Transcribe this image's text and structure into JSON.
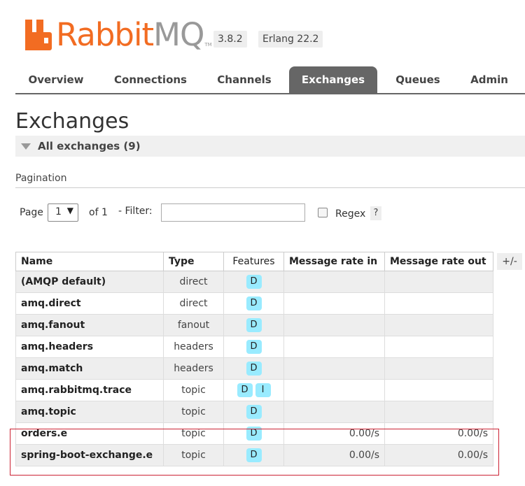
{
  "brand": {
    "logo_rabbit": "Rabbit",
    "logo_mq": "MQ",
    "logo_tm": "TM",
    "accent": "#f26c22"
  },
  "versions": {
    "rabbitmq": "3.8.2",
    "erlang": "Erlang 22.2"
  },
  "tabs": [
    {
      "label": "Overview",
      "active": false
    },
    {
      "label": "Connections",
      "active": false
    },
    {
      "label": "Channels",
      "active": false
    },
    {
      "label": "Exchanges",
      "active": true
    },
    {
      "label": "Queues",
      "active": false
    },
    {
      "label": "Admin",
      "active": false
    }
  ],
  "page": {
    "title": "Exchanges",
    "section_title": "All exchanges (9)"
  },
  "pagination": {
    "label": "Pagination",
    "page_label": "Page",
    "page_value": "1",
    "of_label": "of 1",
    "filter_label": "- Filter:",
    "filter_value": "",
    "regex_label": "Regex",
    "help_label": "?"
  },
  "table": {
    "columns": [
      "Name",
      "Type",
      "Features",
      "Message rate in",
      "Message rate out"
    ],
    "toggle_label": "+/-",
    "rows": [
      {
        "name": "(AMQP default)",
        "type": "direct",
        "features": [
          "D"
        ],
        "rate_in": "",
        "rate_out": ""
      },
      {
        "name": "amq.direct",
        "type": "direct",
        "features": [
          "D"
        ],
        "rate_in": "",
        "rate_out": ""
      },
      {
        "name": "amq.fanout",
        "type": "fanout",
        "features": [
          "D"
        ],
        "rate_in": "",
        "rate_out": ""
      },
      {
        "name": "amq.headers",
        "type": "headers",
        "features": [
          "D"
        ],
        "rate_in": "",
        "rate_out": ""
      },
      {
        "name": "amq.match",
        "type": "headers",
        "features": [
          "D"
        ],
        "rate_in": "",
        "rate_out": ""
      },
      {
        "name": "amq.rabbitmq.trace",
        "type": "topic",
        "features": [
          "D",
          "I"
        ],
        "rate_in": "",
        "rate_out": ""
      },
      {
        "name": "amq.topic",
        "type": "topic",
        "features": [
          "D"
        ],
        "rate_in": "",
        "rate_out": ""
      },
      {
        "name": "orders.e",
        "type": "topic",
        "features": [
          "D"
        ],
        "rate_in": "0.00/s",
        "rate_out": "0.00/s"
      },
      {
        "name": "spring-boot-exchange.e",
        "type": "topic",
        "features": [
          "D"
        ],
        "rate_in": "0.00/s",
        "rate_out": "0.00/s"
      }
    ]
  },
  "colors": {
    "feature_badge": "#99ebff",
    "active_tab": "#666666",
    "highlight": "#cc2233"
  }
}
